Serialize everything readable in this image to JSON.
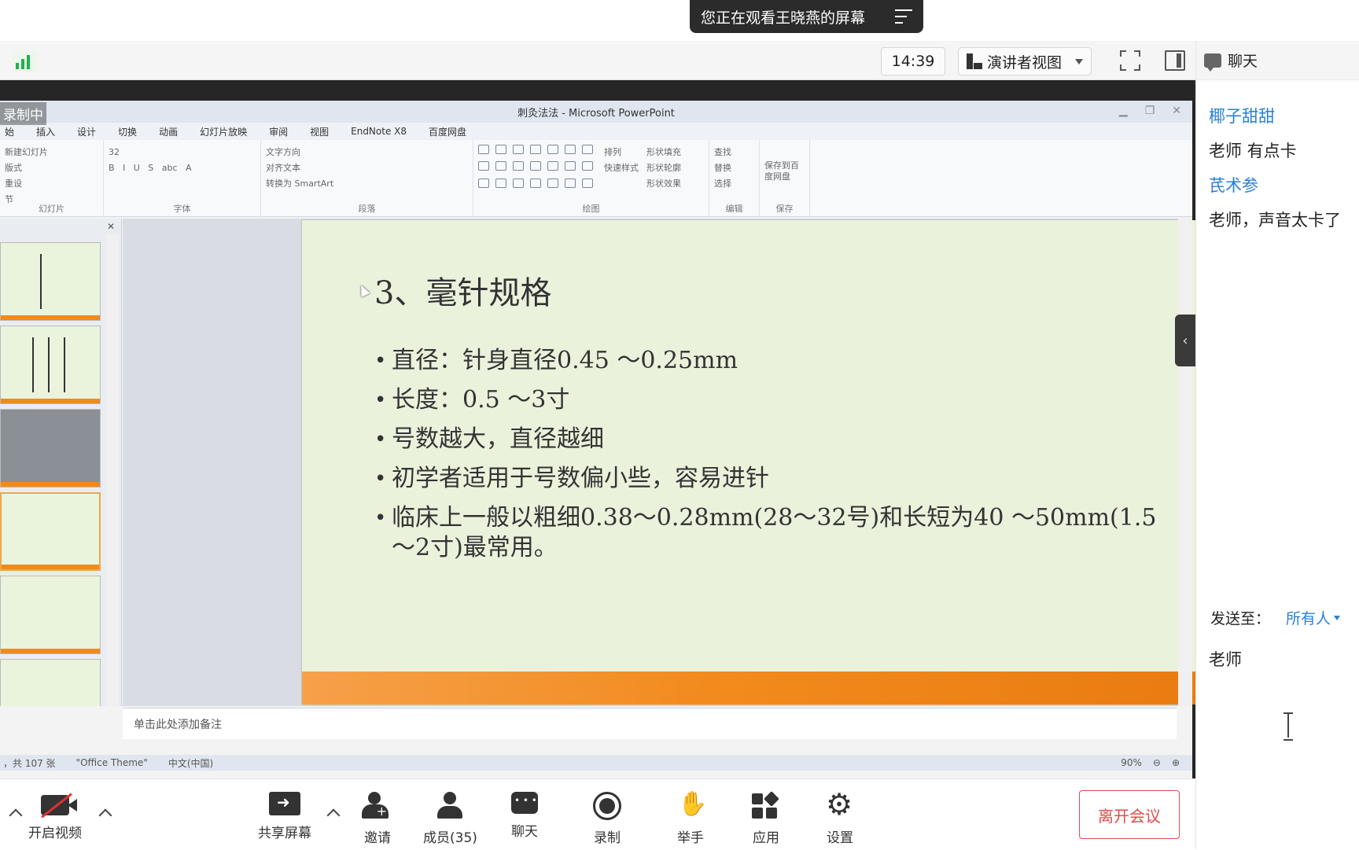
{
  "banner": {
    "text": "您正在观看王晓燕的屏幕"
  },
  "top_bar": {
    "time": "14:39",
    "view_mode": "演讲者视图",
    "signal_color": "#22b14c"
  },
  "chat": {
    "title": "聊天",
    "messages": [
      {
        "sender": "椰子甜甜",
        "text": "老师 有点卡"
      },
      {
        "sender": "芪术参",
        "text": "老师，声音太卡了"
      }
    ],
    "send_to_label": "发送至：",
    "send_to_value": "所有人",
    "input_value": "老师",
    "sender_color": "#2a7fd8"
  },
  "shared_screen": {
    "recording_label": "录制中",
    "ppt": {
      "window_title": "刺灸法法 - Microsoft PowerPoint",
      "menu": [
        "始",
        "插入",
        "设计",
        "切换",
        "动画",
        "幻灯片放映",
        "审阅",
        "视图",
        "EndNote X8",
        "百度网盘"
      ],
      "ribbon": {
        "slides_group": "幻灯片",
        "font_group": "字体",
        "paragraph_group": "段落",
        "drawing_group": "绘图",
        "editing_group": "编辑",
        "save_group": "保存",
        "new_slide": "新建幻灯片",
        "layout": "版式",
        "reset": "重设",
        "section": "节",
        "font_size": "32",
        "text_direction": "文字方向",
        "align_text": "对齐文本",
        "smartart": "转换为 SmartArt",
        "arrange": "排列",
        "quick_styles": "快速样式",
        "shape_fill": "形状填充",
        "shape_outline": "形状轮廓",
        "shape_effects": "形状效果",
        "find": "查找",
        "replace": "替换",
        "select": "选择",
        "save_to_baidu": "保存到百度网盘"
      },
      "slide": {
        "title": "3、毫针规格",
        "bullets": [
          "直径：针身直径0.45 ～0.25mm",
          "长度：0.5 ～3寸",
          "号数越大，直径越细",
          "初学者适用于号数偏小些，容易进针",
          "临床上一般以粗细0.38～0.28mm(28～32号)和长短为40 ～50mm(1.5 ～2寸)最常用。"
        ],
        "background_color": "#eaf2dc",
        "footer_color": "#f28a1c"
      },
      "notes_placeholder": "单击此处添加备注",
      "status": {
        "slide_count": "，共 107 张",
        "theme": "\"Office Theme\"",
        "language": "中文(中国)",
        "zoom": "90%"
      }
    }
  },
  "meeting_bar": {
    "video": "开启视频",
    "share": "共享屏幕",
    "invite": "邀请",
    "members": "成员(35)",
    "chat": "聊天",
    "record": "录制",
    "raise_hand": "举手",
    "apps": "应用",
    "settings": "设置",
    "leave": "离开会议",
    "leave_color": "#e24a4a"
  }
}
